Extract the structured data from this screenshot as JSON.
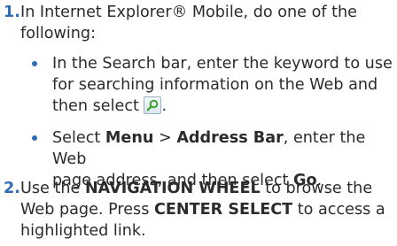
{
  "steps": [
    {
      "number": "1.",
      "line1": "In Internet Explorer® Mobile, do one of the",
      "line2": "following:"
    },
    {
      "number": "2.",
      "line1_pre": "Use the ",
      "line1_bold": "NAVIGATION WHEEL",
      "line1_post": " to browse the",
      "line2_pre": "Web page. Press ",
      "line2_bold": "CENTER SELECT",
      "line2_post": " to access a",
      "line3": "highlighted link."
    }
  ],
  "bullets": [
    {
      "line1": "In the Search bar, enter the keyword to use",
      "line2": "for searching information on the Web and",
      "line3_pre": "then select ",
      "line3_post": ".",
      "icon": "search-icon"
    },
    {
      "pre1": "Select ",
      "bold1": "Menu",
      "sep": " > ",
      "bold2": "Address Bar",
      "post1": ", enter the Web",
      "line2_pre": "page address, and then select ",
      "bold3": "Go",
      "line2_post": "."
    }
  ],
  "colors": {
    "accent": "#2f6db6",
    "text": "#2b2b2b",
    "icon_green": "#3aa52e"
  }
}
